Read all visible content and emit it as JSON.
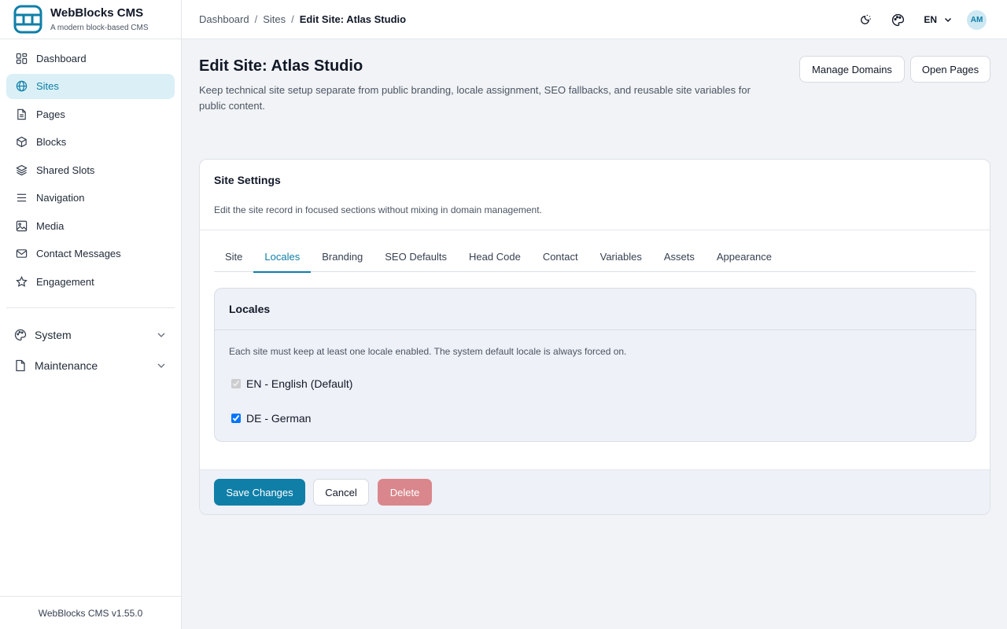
{
  "app": {
    "title": "WebBlocks CMS",
    "subtitle": "A modern block-based CMS",
    "version": "WebBlocks CMS v1.55.0"
  },
  "sidebar": {
    "items": [
      {
        "label": "Dashboard",
        "icon": "dashboard-icon"
      },
      {
        "label": "Sites",
        "icon": "globe-icon",
        "active": true
      },
      {
        "label": "Pages",
        "icon": "file-icon"
      },
      {
        "label": "Blocks",
        "icon": "cube-icon"
      },
      {
        "label": "Shared Slots",
        "icon": "layers-icon"
      },
      {
        "label": "Navigation",
        "icon": "menu-icon"
      },
      {
        "label": "Media",
        "icon": "image-icon"
      },
      {
        "label": "Contact Messages",
        "icon": "mail-icon"
      },
      {
        "label": "Engagement",
        "icon": "star-icon"
      }
    ],
    "groups": [
      {
        "label": "System",
        "icon": "palette-icon"
      },
      {
        "label": "Maintenance",
        "icon": "file-icon"
      }
    ]
  },
  "breadcrumb": {
    "items": [
      "Dashboard",
      "Sites"
    ],
    "current": "Edit Site: Atlas Studio"
  },
  "topbar": {
    "language": "EN",
    "avatar_initials": "AM"
  },
  "page": {
    "title": "Edit Site: Atlas Studio",
    "description": "Keep technical site setup separate from public branding, locale assignment, SEO fallbacks, and reusable site variables for public content.",
    "manage_domains_label": "Manage Domains",
    "open_pages_label": "Open Pages"
  },
  "card": {
    "title": "Site Settings",
    "description": "Edit the site record in focused sections without mixing in domain management.",
    "tabs": [
      "Site",
      "Locales",
      "Branding",
      "SEO Defaults",
      "Head Code",
      "Contact",
      "Variables",
      "Assets",
      "Appearance"
    ],
    "active_tab": "Locales"
  },
  "locales": {
    "title": "Locales",
    "description": "Each site must keep at least one locale enabled. The system default locale is always forced on.",
    "options": [
      {
        "label": "EN - English (Default)",
        "checked": true,
        "disabled": true
      },
      {
        "label": "DE - German",
        "checked": true,
        "disabled": false
      }
    ]
  },
  "footer": {
    "save_label": "Save Changes",
    "cancel_label": "Cancel",
    "delete_label": "Delete"
  },
  "colors": {
    "accent": "#0f7fa8",
    "active_nav_bg": "#daf0f6",
    "danger": "#d9878c"
  }
}
